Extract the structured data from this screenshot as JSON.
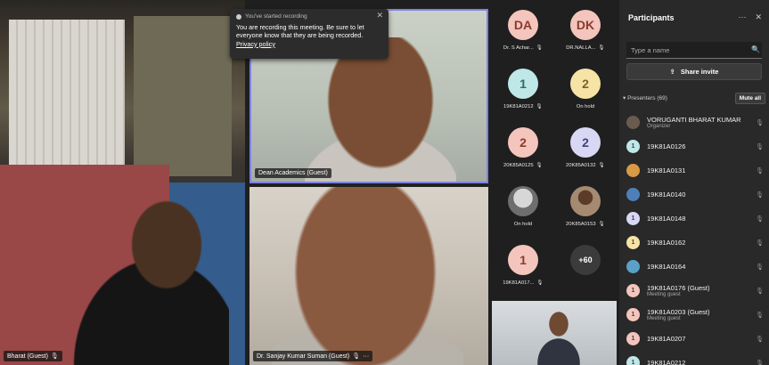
{
  "toast": {
    "header": "You've started recording",
    "message": "You are recording this meeting. Be sure to let everyone know that they are being recorded.",
    "link": "Privacy policy"
  },
  "videos": {
    "bharat": "Bharat (Guest)",
    "dean": "Dean Academics (Guest)",
    "sanjay": "Dr. Sanjay Kumar Suman (Guest)",
    "sanjay_more": "···"
  },
  "gallery": [
    {
      "initials": "DA",
      "label": "Dr. S Achar...",
      "color": "#f4c5bd",
      "textColor": "#8a3b2e"
    },
    {
      "initials": "DK",
      "label": "DR.NALLA...",
      "color": "#f4c5bd",
      "textColor": "#8a3b2e"
    },
    {
      "initials": "1",
      "label": "19K81A0212",
      "color": "#bfe7e7",
      "textColor": "#2d6c6c"
    },
    {
      "initials": "2",
      "label": "On hold",
      "color": "#f6e3a6",
      "textColor": "#7b6220"
    },
    {
      "initials": "2",
      "label": "20K85A0125",
      "color": "#f4c5bd",
      "textColor": "#8a3b2e"
    },
    {
      "initials": "2",
      "label": "20K85A0132",
      "color": "#d8d8f5",
      "textColor": "#41417a"
    },
    {
      "initials": "",
      "label": "On hold",
      "color": "photo",
      "textColor": "#fff"
    },
    {
      "initials": "",
      "label": "20K85A0153",
      "color": "photo2",
      "textColor": "#fff"
    },
    {
      "initials": "1",
      "label": "19K81A017...",
      "color": "#f4c5bd",
      "textColor": "#8a3b2e"
    },
    {
      "initials": "+60",
      "label": "",
      "color": "#3b3b3b",
      "textColor": "#fff"
    }
  ],
  "panel": {
    "title": "Participants",
    "more_icon": "···",
    "close_icon": "✕",
    "search_placeholder": "Type a name",
    "share_label": "Share invite",
    "presenters_label": "Presenters (69)",
    "mute_all": "Mute all"
  },
  "participants": [
    {
      "name": "VORUGANTI BHARAT KUMAR",
      "sub": "Organizer",
      "initial": "",
      "color": "#6b5a4e"
    },
    {
      "name": "19K81A0126",
      "sub": "",
      "initial": "1",
      "color": "#bfe7e7"
    },
    {
      "name": "19K81A0131",
      "sub": "",
      "initial": "",
      "color": "#d99a45"
    },
    {
      "name": "19K81A0140",
      "sub": "",
      "initial": "",
      "color": "#4f7fb8"
    },
    {
      "name": "19K81A0148",
      "sub": "",
      "initial": "1",
      "color": "#d8d8f5"
    },
    {
      "name": "19K81A0162",
      "sub": "",
      "initial": "1",
      "color": "#f6e3a6"
    },
    {
      "name": "19K81A0164",
      "sub": "",
      "initial": "",
      "color": "#5aa0c8"
    },
    {
      "name": "19K81A0176 (Guest)",
      "sub": "Meeting guest",
      "initial": "1",
      "color": "#f4c5bd"
    },
    {
      "name": "19K81A0203 (Guest)",
      "sub": "Meeting guest",
      "initial": "1",
      "color": "#f4c5bd"
    },
    {
      "name": "19K81A0207",
      "sub": "",
      "initial": "1",
      "color": "#f4c5bd"
    },
    {
      "name": "19K81A0212",
      "sub": "",
      "initial": "1",
      "color": "#bfe7e7"
    }
  ]
}
